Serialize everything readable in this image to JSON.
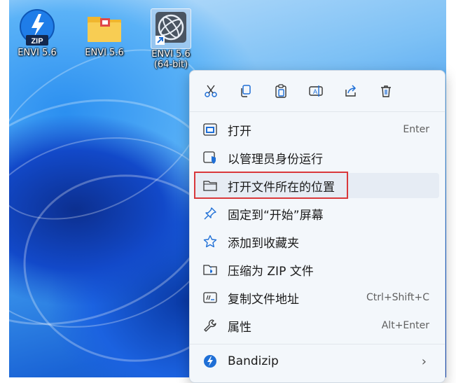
{
  "desktop": {
    "icons": [
      {
        "label": "ENVI 5.6",
        "glyph": "ZIP",
        "icon": "zip-archive-icon"
      },
      {
        "label": "ENVI 5.6",
        "icon": "folder-icon"
      },
      {
        "label": "ENVI 5.6\n(64-bit)",
        "icon": "envi-globe-shortcut-icon"
      }
    ]
  },
  "context_menu": {
    "toolbar": [
      {
        "name": "cut-icon"
      },
      {
        "name": "copy-icon"
      },
      {
        "name": "paste-icon"
      },
      {
        "name": "rename-icon"
      },
      {
        "name": "share-icon"
      },
      {
        "name": "delete-icon"
      }
    ],
    "items": [
      {
        "label": "打开",
        "shortcut": "Enter",
        "icon": "open-window-icon"
      },
      {
        "label": "以管理员身份运行",
        "icon": "admin-shield-icon"
      },
      {
        "label": "打开文件所在的位置",
        "icon": "folder-outline-icon"
      },
      {
        "label": "固定到“开始”屏幕",
        "icon": "pin-icon"
      },
      {
        "label": "添加到收藏夹",
        "icon": "star-icon"
      },
      {
        "label": "压缩为 ZIP 文件",
        "icon": "zip-folder-icon"
      },
      {
        "label": "复制文件地址",
        "shortcut": "Ctrl+Shift+C",
        "icon": "copy-path-icon"
      },
      {
        "label": "属性",
        "shortcut": "Alt+Enter",
        "icon": "wrench-icon"
      },
      {
        "label": "Bandizip",
        "icon": "bandizip-icon"
      }
    ]
  },
  "colors": {
    "menu_bg": "#f3f7fb",
    "hover_bg": "#e6ecf4",
    "highlight_border": "#d9383b",
    "accent": "#1f6fd6"
  }
}
